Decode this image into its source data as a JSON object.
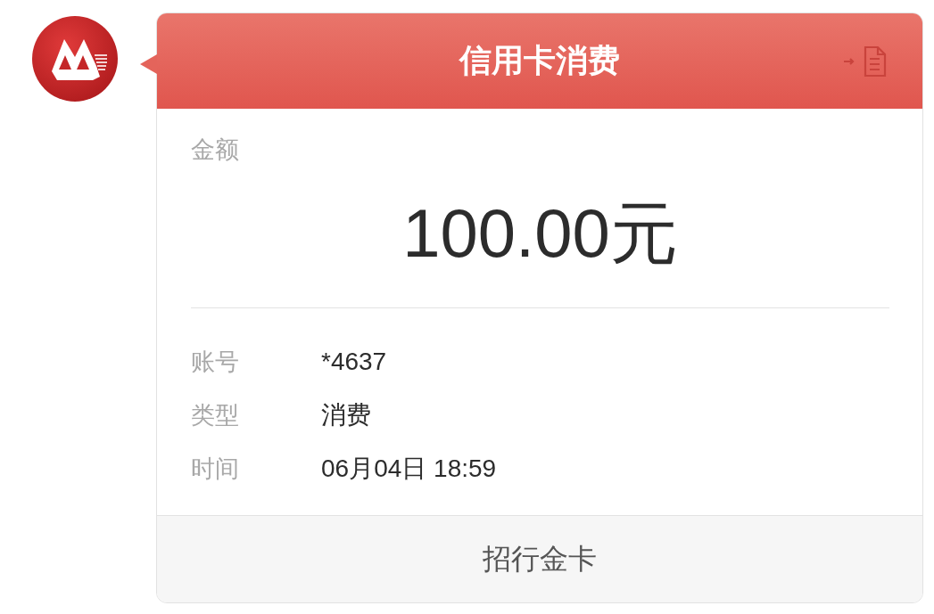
{
  "message": {
    "title": "信用卡消费",
    "amount_label": "金额",
    "amount": "100.00元",
    "details": [
      {
        "label": "账号",
        "value": "*4637"
      },
      {
        "label": "类型",
        "value": "消费"
      },
      {
        "label": "时间",
        "value": "06月04日 18:59"
      }
    ],
    "footer": "招行金卡"
  }
}
